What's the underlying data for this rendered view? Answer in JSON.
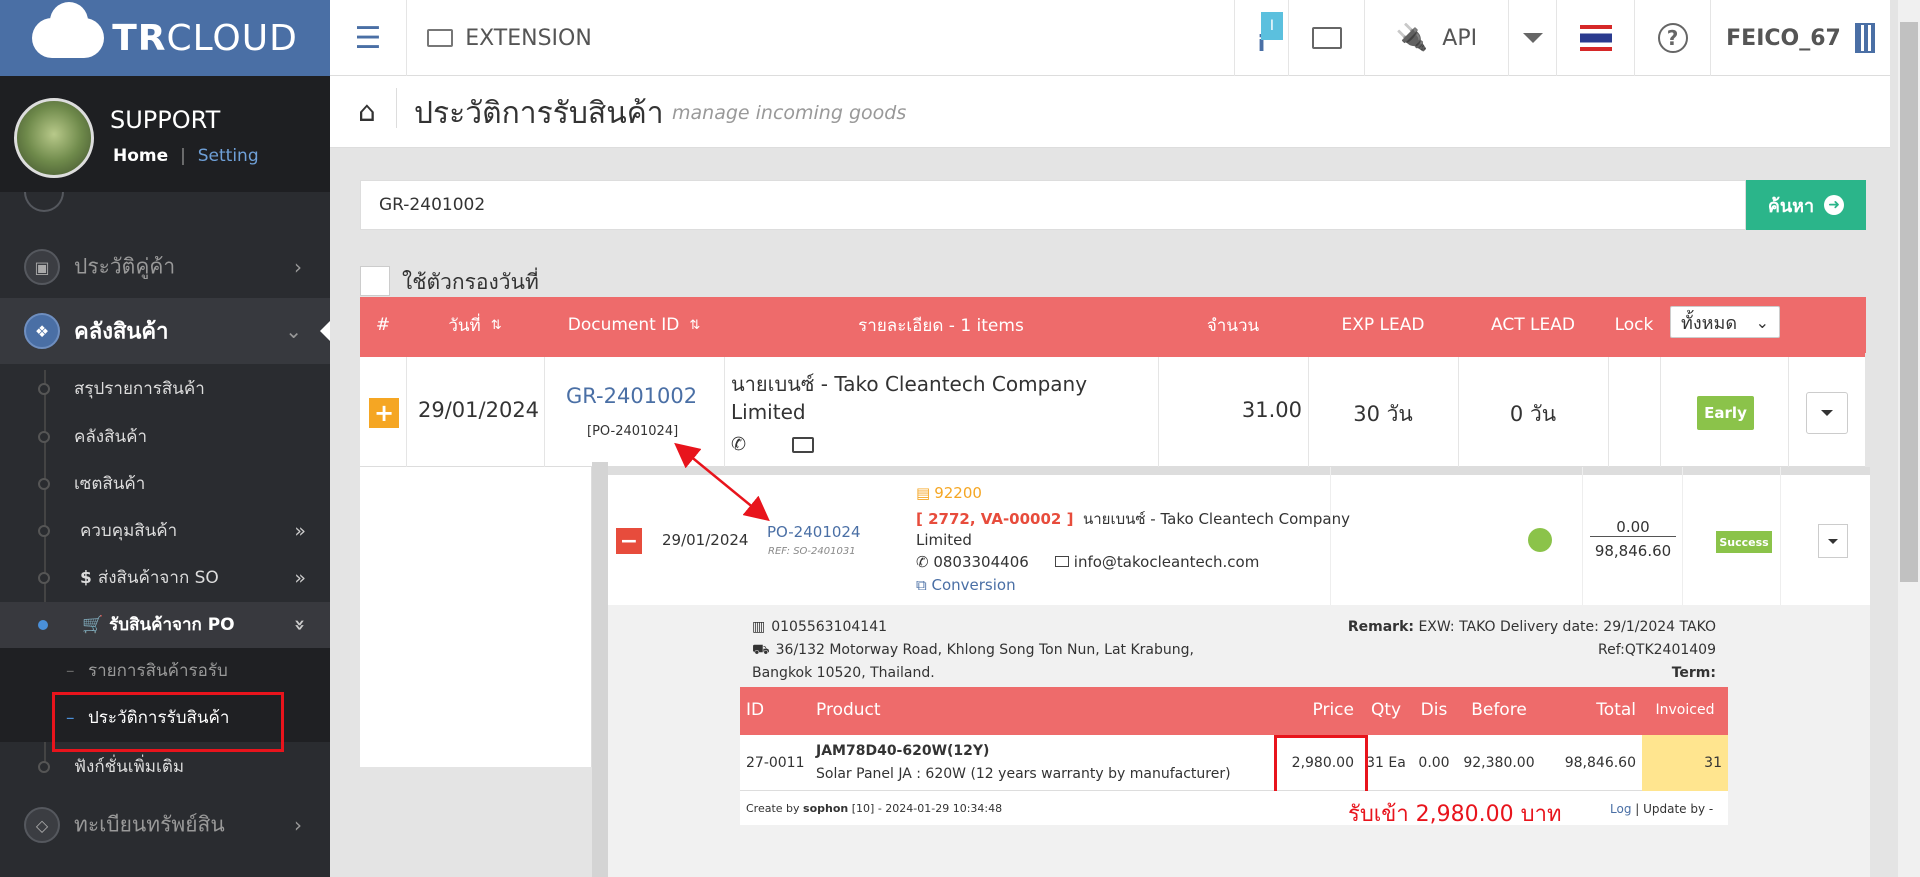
{
  "brand": {
    "logo_strong": "TR",
    "logo_thin": "CLOUD"
  },
  "profile": {
    "name": "SUPPORT",
    "home": "Home",
    "sep": "|",
    "setting": "Setting"
  },
  "sidebar": {
    "partner_history": "ประวัติคู่ค้า",
    "warehouse": "คลังสินค้า",
    "subs": [
      "สรุปรายการสินค้า",
      "คลังสินค้า",
      "เซตสินค้า",
      "ควบคุมสินค้า",
      "ส่งสินค้าจาก SO",
      "รับสินค้าจาก PO"
    ],
    "po_subs": [
      "รายการสินค้ารอรับ",
      "ประวัติการรับสินค้า"
    ],
    "extra": "ฟังก์ชั่นเพิ่มเติม",
    "assets": "ทะเบียนทรัพย์สิน"
  },
  "topbar": {
    "extension": "EXTENSION",
    "info_badge": "I",
    "api": "API",
    "user": "FEICO_67"
  },
  "page": {
    "title": "ประวัติการรับสินค้า",
    "subtitle": "manage incoming goods"
  },
  "search": {
    "value": "GR-2401002",
    "button": "ค้นหา"
  },
  "filter": {
    "label": "ใช้ตัวกรองวันที่"
  },
  "table": {
    "headers": {
      "num": "#",
      "date": "วันที่",
      "doc": "Document ID",
      "detail": "รายละเอียด - 1 items",
      "qty": "จำนวน",
      "exp": "EXP LEAD",
      "act": "ACT LEAD",
      "lock": "Lock",
      "filter": "ทั้งหมด"
    },
    "row": {
      "date": "29/01/2024",
      "doc": "GR-2401002",
      "ref": "[PO-2401024]",
      "vendor": "นายเบนซ์ - Tako Cleantech Company",
      "vendor2": "Limited",
      "qty": "31.00",
      "exp": "30 วัน",
      "act": "0 วัน",
      "badge": "Early"
    }
  },
  "po": {
    "date": "29/01/2024",
    "id": "PO-2401024",
    "ref": "REF: SO-2401031",
    "code": "92200",
    "codes": "[ 2772, VA-00002 ]",
    "vendor": "นายเบนซ์ - Tako Cleantech Company",
    "vendor2": "Limited",
    "phone": "0803304406",
    "email": "info@takocleantech.com",
    "conversion": "Conversion",
    "amount_top": "0.00",
    "amount_bottom": "98,846.60",
    "badge": "Success"
  },
  "detail": {
    "tax": "0105563104141",
    "address1": "36/132 Motorway Road, Khlong Song Ton Nun, Lat Krabung,",
    "address2": "Bangkok 10520, Thailand.",
    "remark_label": "Remark:",
    "remark": "EXW: TAKO Delivery date: 29/1/2024 TAKO",
    "remark2": "Ref:QTK2401409",
    "term_label": "Term:",
    "headers": {
      "id": "ID",
      "product": "Product",
      "price": "Price",
      "qty": "Qty",
      "dis": "Dis",
      "before": "Before",
      "total": "Total",
      "invoiced": "Invoiced"
    },
    "item": {
      "id": "27-0011",
      "name": "JAM78D40-620W(12Y)",
      "desc": "Solar Panel JA : 620W (12 years warranty by manufacturer)",
      "price": "2,980.00",
      "qty": "31 Ea",
      "dis": "0.00",
      "before": "92,380.00",
      "total": "98,846.60",
      "invoiced": "31"
    },
    "created_pre": "Create by ",
    "created_user": "sophon",
    "created_post": " [10] - 2024-01-29 10:34:48",
    "log": "Log",
    "update": " | Update by -"
  },
  "annotation": {
    "note": "รับเข้า 2,980.00 บาท"
  }
}
